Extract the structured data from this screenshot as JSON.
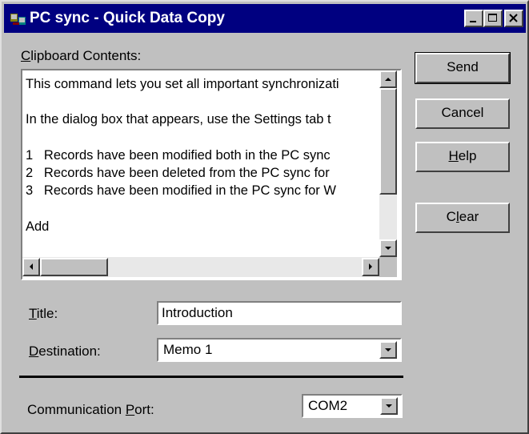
{
  "window": {
    "title": "PC sync - Quick Data Copy",
    "controls": [
      "minimize-icon",
      "maximize-icon",
      "close-icon"
    ]
  },
  "clipboard": {
    "label_accel": "C",
    "label_rest": "lipboard Contents:",
    "text": "This command lets you set all important synchronizati\n\nIn the dialog box that appears, use the Settings tab t\n\n1   Records have been modified both in the PC sync\n2   Records have been deleted from the PC sync for\n3   Records have been modified in the PC sync for W\n\nAdd"
  },
  "buttons": {
    "send": "Send",
    "cancel": "Cancel",
    "help_accel": "H",
    "help_rest": "elp",
    "clear_pre": "C",
    "clear_accel": "l",
    "clear_rest": "ear"
  },
  "title_field": {
    "label_accel": "T",
    "label_rest": "itle:",
    "value": "Introduction"
  },
  "destination": {
    "label_accel": "D",
    "label_rest": "estination:",
    "value": "Memo 1"
  },
  "port": {
    "label_pre": "Communication ",
    "label_accel": "P",
    "label_rest": "ort:",
    "value": "COM2"
  },
  "colors": {
    "titlebar": "#000080",
    "face": "#c0c0c0"
  }
}
